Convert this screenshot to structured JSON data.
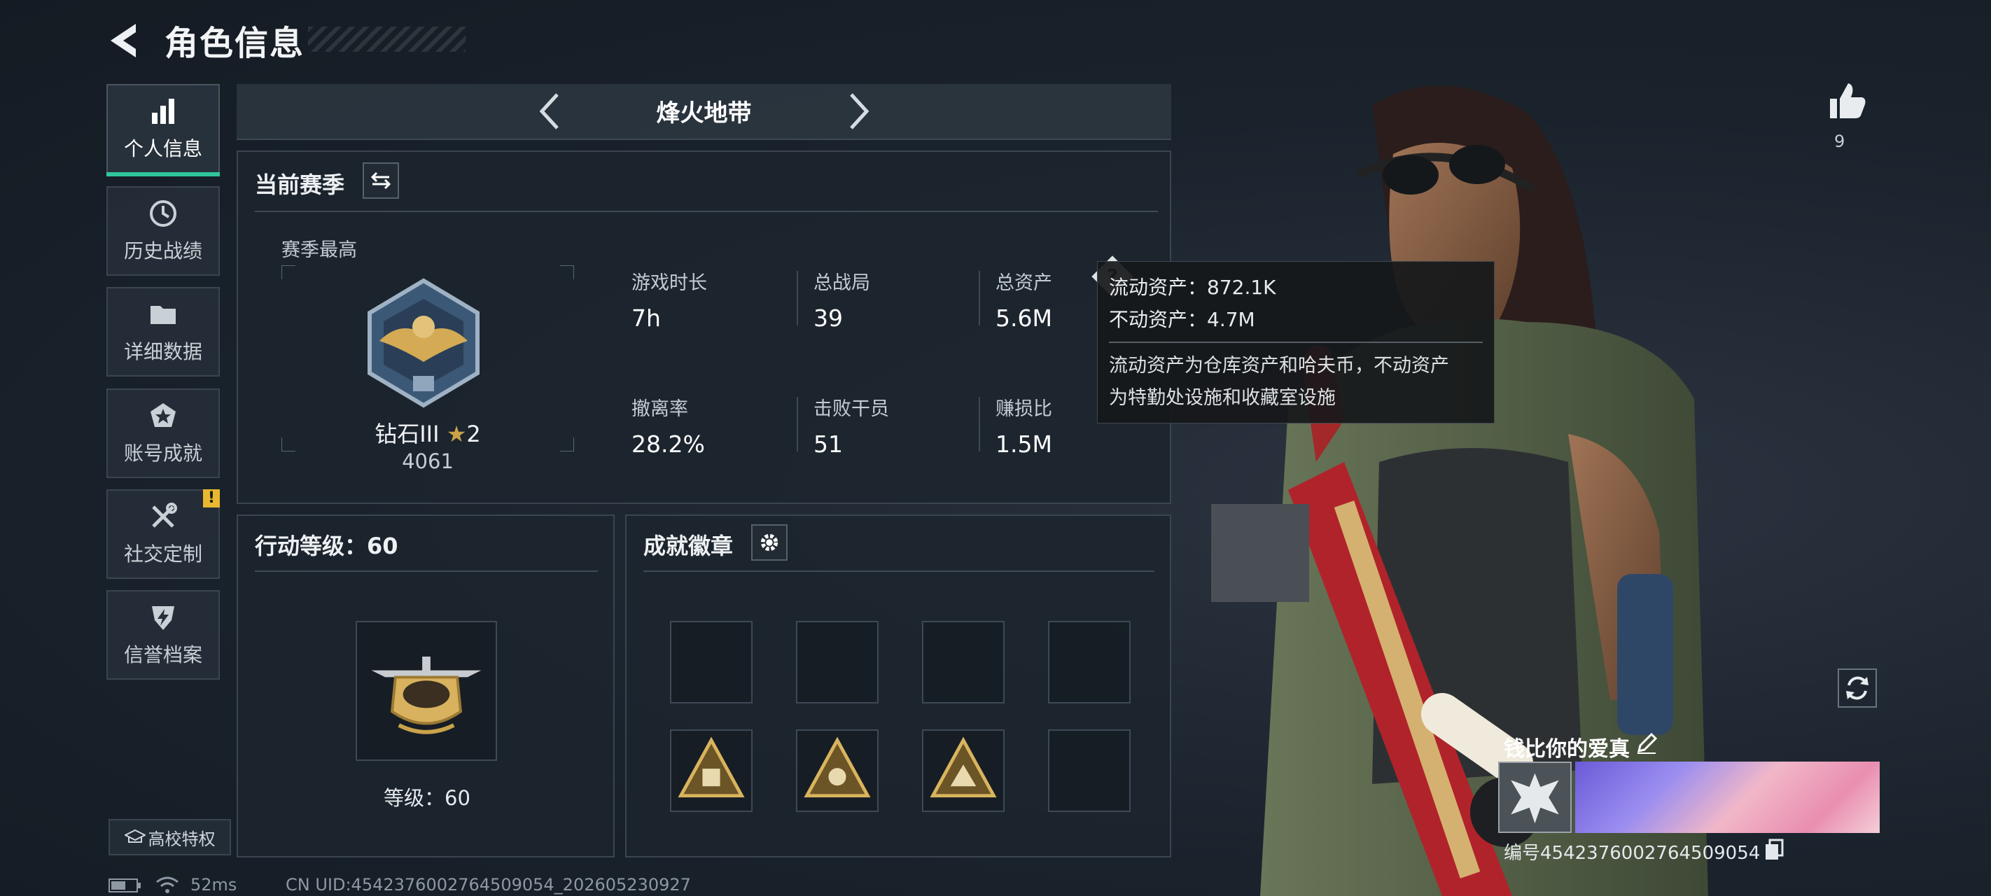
{
  "header": {
    "title": "角色信息"
  },
  "sidebar": {
    "items": [
      {
        "label": "个人信息",
        "icon": "bar-chart-icon",
        "active": true
      },
      {
        "label": "历史战绩",
        "icon": "clock-history-icon"
      },
      {
        "label": "详细数据",
        "icon": "folder-icon"
      },
      {
        "label": "账号成就",
        "icon": "medal-star-icon"
      },
      {
        "label": "社交定制",
        "icon": "tools-icon",
        "badge": "!"
      },
      {
        "label": "信誉档案",
        "icon": "shield-bolt-icon"
      }
    ],
    "university_button": "高校特权"
  },
  "mode_selector": {
    "current": "烽火地带"
  },
  "current_season": {
    "title": "当前赛季",
    "best_label": "赛季最高",
    "rank_name": "钻石III",
    "rank_stars": "2",
    "rank_score": "4061",
    "stats": [
      {
        "label": "游戏时长",
        "value": "7h"
      },
      {
        "label": "总战局",
        "value": "39"
      },
      {
        "label": "总资产",
        "value": "5.6M",
        "has_help": true
      },
      {
        "label": "撤离率",
        "value": "28.2%"
      },
      {
        "label": "击败干员",
        "value": "51"
      },
      {
        "label": "赚损比",
        "value": "1.5M"
      }
    ]
  },
  "tooltip": {
    "liquid": "流动资产：872.1K",
    "fixed": "不动资产：4.7M",
    "desc_line1": "流动资产为仓库资产和哈夫币，不动资产",
    "desc_line2": "为特勤处设施和收藏室设施"
  },
  "action_level": {
    "title": "行动等级：60",
    "level_text": "等级：60"
  },
  "achievements": {
    "title": "成就徽章"
  },
  "profile": {
    "likes": "9",
    "nickname": "钱比你的爱真",
    "uid_text": "编号4542376002764509054"
  },
  "status_bar": {
    "ping": "52ms",
    "uid": "CN UID:4542376002764509054_202605230927"
  },
  "colors": {
    "accent": "#2fc79b",
    "warning": "#e8b830",
    "gold": "#c9a24a"
  }
}
